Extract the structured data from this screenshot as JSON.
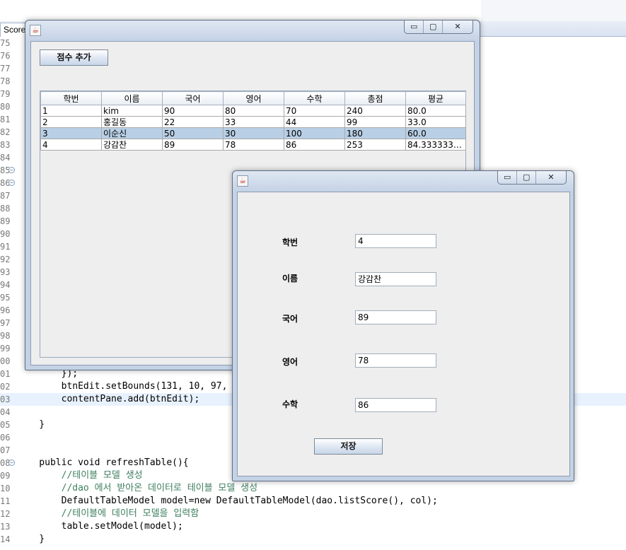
{
  "editor": {
    "tab_title": "ScoreLi",
    "lines": [
      {
        "num": "75",
        "code": ""
      },
      {
        "num": "76",
        "code": ""
      },
      {
        "num": "77",
        "code": ""
      },
      {
        "num": "78",
        "code": ""
      },
      {
        "num": "79",
        "code": ""
      },
      {
        "num": "80",
        "code": ""
      },
      {
        "num": "81",
        "code": ""
      },
      {
        "num": "82",
        "code": ""
      },
      {
        "num": "83",
        "code": ""
      },
      {
        "num": "84",
        "code": ""
      },
      {
        "num": "85",
        "code": ""
      },
      {
        "num": "86",
        "code": ""
      },
      {
        "num": "87",
        "code": ""
      },
      {
        "num": "88",
        "code": ""
      },
      {
        "num": "89",
        "code": ""
      },
      {
        "num": "90",
        "code": ""
      },
      {
        "num": "91",
        "code": ""
      },
      {
        "num": "92",
        "code": ""
      },
      {
        "num": "93",
        "code": ""
      },
      {
        "num": "94",
        "code": ""
      },
      {
        "num": "95",
        "code": ""
      },
      {
        "num": "96",
        "code": ""
      },
      {
        "num": "97",
        "code": ""
      },
      {
        "num": "98",
        "code": ""
      },
      {
        "num": "99",
        "code": ""
      },
      {
        "num": "00",
        "code": ""
      },
      {
        "num": "01",
        "code": "        });"
      },
      {
        "num": "02",
        "code": "        btnEdit.setBounds(131, 10, 97,"
      },
      {
        "num": "03",
        "code": "        contentPane.add(btnEdit);"
      },
      {
        "num": "04",
        "code": ""
      },
      {
        "num": "05",
        "code": "    }"
      },
      {
        "num": "06",
        "code": ""
      },
      {
        "num": "07",
        "code": ""
      },
      {
        "num": "08",
        "code": "    public void refreshTable(){"
      },
      {
        "num": "09",
        "code": "        //테이블 모델 생성"
      },
      {
        "num": "10",
        "code": "        //dao 에서 받아온 데이터로 테이블 모델 생성"
      },
      {
        "num": "11",
        "code": "        DefaultTableModel model=new DefaultTableModel(dao.listScore(), col);"
      },
      {
        "num": "12",
        "code": "        //테이블에 데이터 모델을 입력함"
      },
      {
        "num": "13",
        "code": "        table.setModel(model);"
      },
      {
        "num": "14",
        "code": "    }"
      }
    ]
  },
  "main_window": {
    "buttons": {
      "minimize": "▭",
      "maximize": "▢",
      "close": "✕"
    },
    "add_score_button": "점수 추가",
    "table": {
      "columns": [
        "학번",
        "이름",
        "국어",
        "영어",
        "수학",
        "총점",
        "평균"
      ],
      "rows": [
        [
          "1",
          "kim",
          "90",
          "80",
          "70",
          "240",
          "80.0"
        ],
        [
          "2",
          "홍길동",
          "22",
          "33",
          "44",
          "99",
          "33.0"
        ],
        [
          "3",
          "이순신",
          "50",
          "30",
          "100",
          "180",
          "60.0"
        ],
        [
          "4",
          "강감찬",
          "89",
          "78",
          "86",
          "253",
          "84.33333333..."
        ]
      ],
      "selected_row": 2
    }
  },
  "edit_window": {
    "buttons": {
      "minimize": "▭",
      "maximize": "▢",
      "close": "✕"
    },
    "fields": {
      "student_id": {
        "label": "학번",
        "value": "4"
      },
      "name": {
        "label": "이름",
        "value": "강감찬"
      },
      "korean": {
        "label": "국어",
        "value": "89"
      },
      "english": {
        "label": "영어",
        "value": "78"
      },
      "math": {
        "label": "수학",
        "value": "86"
      }
    },
    "save_button": "저장"
  }
}
